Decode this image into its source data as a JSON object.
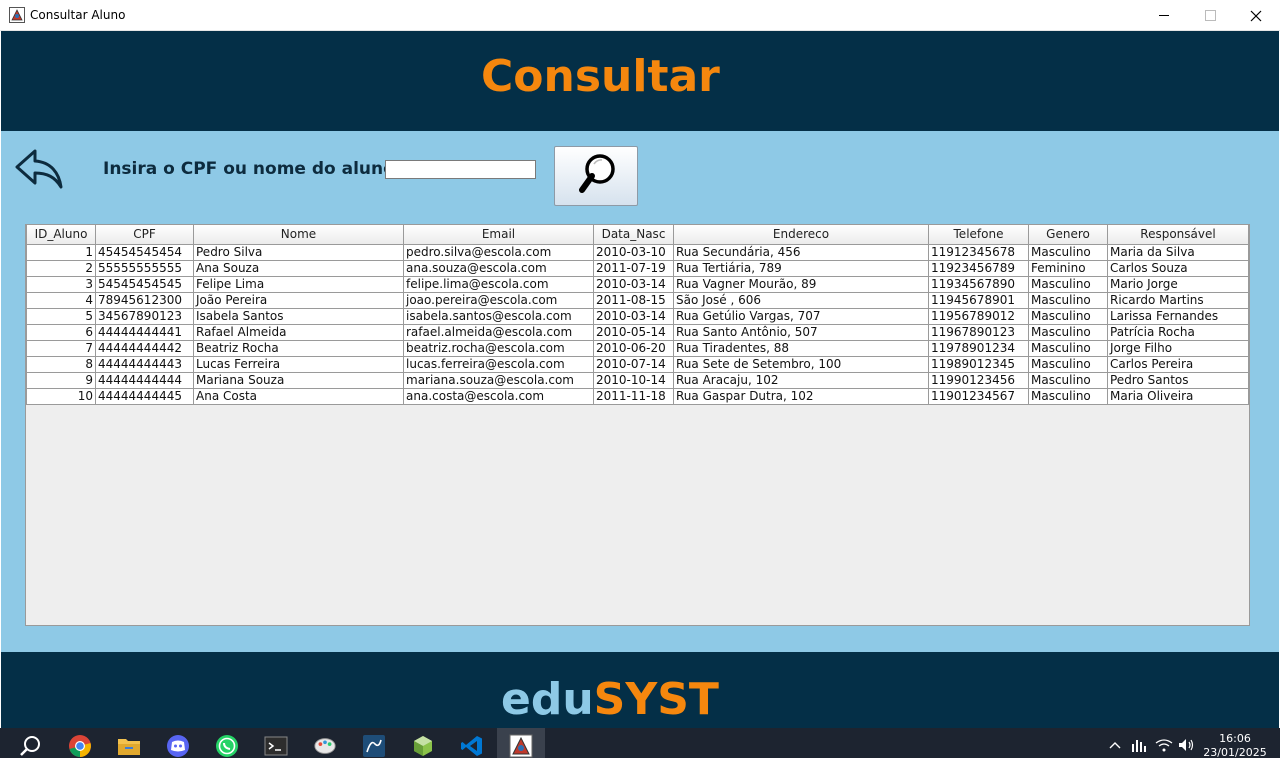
{
  "window": {
    "title": "Consultar Aluno"
  },
  "header": {
    "title": "Consultar"
  },
  "search": {
    "label": "Insira o CPF ou nome do aluno:",
    "value": "",
    "placeholder": ""
  },
  "table": {
    "columns": [
      "ID_Aluno",
      "CPF",
      "Nome",
      "Email",
      "Data_Nasc",
      "Endereco",
      "Telefone",
      "Genero",
      "Responsável"
    ],
    "rows": [
      [
        "1",
        "45454545454",
        "Pedro Silva",
        "pedro.silva@escola.com",
        "2010-03-10",
        "Rua Secundária, 456",
        "11912345678",
        "Masculino",
        "Maria da Silva"
      ],
      [
        "2",
        "55555555555",
        "Ana Souza",
        "ana.souza@escola.com",
        "2011-07-19",
        "Rua Tertiária, 789",
        "11923456789",
        "Feminino",
        "Carlos Souza"
      ],
      [
        "3",
        "54545454545",
        "Felipe Lima",
        "felipe.lima@escola.com",
        "2010-03-14",
        "Rua Vagner Mourão, 89",
        "11934567890",
        "Masculino",
        "Mario Jorge"
      ],
      [
        "4",
        "78945612300",
        "João Pereira",
        "joao.pereira@escola.com",
        "2011-08-15",
        "São José , 606",
        "11945678901",
        "Masculino",
        "Ricardo Martins"
      ],
      [
        "5",
        "34567890123",
        "Isabela Santos",
        "isabela.santos@escola.com",
        "2010-03-14",
        "Rua Getúlio Vargas, 707",
        "11956789012",
        "Masculino",
        "Larissa Fernandes"
      ],
      [
        "6",
        "44444444441",
        "Rafael Almeida",
        "rafael.almeida@escola.com",
        "2010-05-14",
        "Rua Santo Antônio, 507",
        "11967890123",
        "Masculino",
        "Patrícia Rocha"
      ],
      [
        "7",
        "44444444442",
        "Beatriz Rocha",
        "beatriz.rocha@escola.com",
        "2010-06-20",
        "Rua Tiradentes, 88",
        "11978901234",
        "Masculino",
        "Jorge Filho"
      ],
      [
        "8",
        "44444444443",
        "Lucas Ferreira",
        "lucas.ferreira@escola.com",
        "2010-07-14",
        "Rua Sete de Setembro, 100",
        "11989012345",
        "Masculino",
        "Carlos Pereira"
      ],
      [
        "9",
        "44444444444",
        "Mariana Souza",
        "mariana.souza@escola.com",
        "2010-10-14",
        "Rua Aracaju, 102",
        "11990123456",
        "Masculino",
        "Pedro Santos"
      ],
      [
        "10",
        "44444444445",
        "Ana Costa",
        "ana.costa@escola.com",
        "2011-11-18",
        "Rua Gaspar Dutra, 102",
        "11901234567",
        "Masculino",
        "Maria Oliveira"
      ]
    ]
  },
  "footer": {
    "brand_part1": "edu",
    "brand_part2": "SYST"
  },
  "taskbar": {
    "icons": [
      "search-icon",
      "chrome-icon",
      "file-explorer-icon",
      "discord-icon",
      "whatsapp-icon",
      "terminal-icon",
      "app-icon",
      "mysql-workbench-icon",
      "app-icon",
      "vscode-icon",
      "java-app-icon"
    ],
    "clock_time": "16:06",
    "clock_date": "23/01/2025"
  },
  "colors": {
    "navy": "#042f47",
    "orange": "#f5870e",
    "light_blue": "#8ec9e6"
  }
}
